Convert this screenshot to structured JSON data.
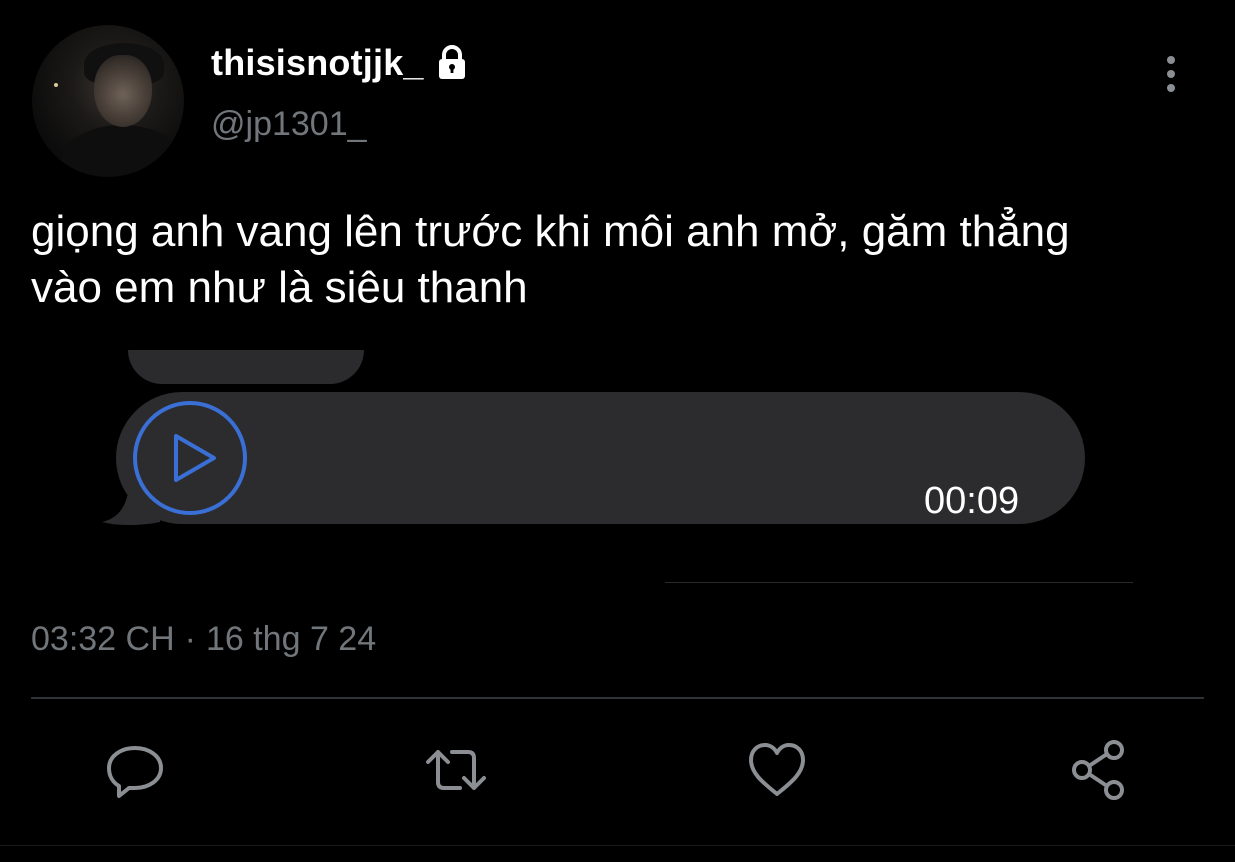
{
  "author": {
    "display_name": "thisisnotjjk_",
    "handle": "@jp1301_",
    "protected_icon": "lock-icon"
  },
  "tweet": {
    "text_lines": [
      "giọng anh vang lên trước khi môi anh mở, găm thẳng",
      "vào em như là siêu thanh"
    ]
  },
  "media": {
    "type": "voice-message",
    "duration": "00:09",
    "play_icon": "play-icon",
    "accent_color": "#3a6fd6"
  },
  "meta": {
    "time": "03:32 CH",
    "separator": "·",
    "date": "16 thg 7 24"
  },
  "actions": [
    {
      "icon": "reply-icon"
    },
    {
      "icon": "retweet-icon"
    },
    {
      "icon": "like-icon"
    },
    {
      "icon": "share-icon"
    }
  ],
  "colors": {
    "background": "#000000",
    "text_primary": "#ffffff",
    "text_secondary": "#71767b",
    "divider": "#2f3336",
    "bubble": "#2c2c2e"
  }
}
